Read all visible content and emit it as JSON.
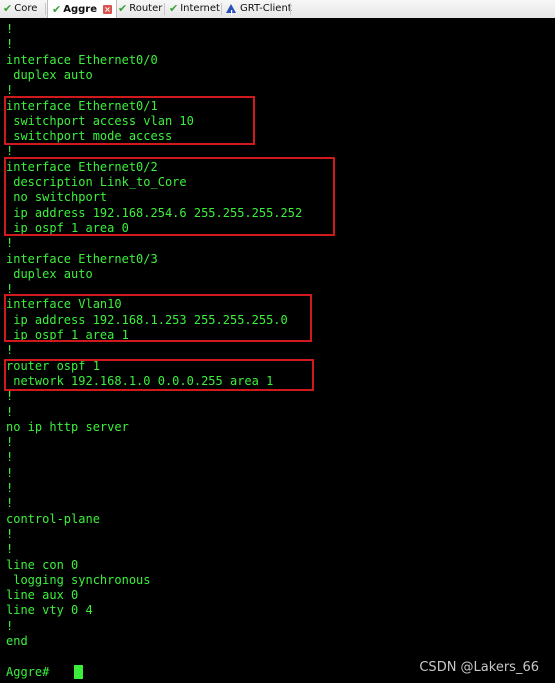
{
  "tabs": [
    {
      "label": "Core",
      "status": "ok"
    },
    {
      "label": "Aggre",
      "status": "ok",
      "active": true
    },
    {
      "label": "Router",
      "status": "ok"
    },
    {
      "label": "Internet",
      "status": "ok"
    },
    {
      "label": "GRT-Client",
      "status": "warning"
    }
  ],
  "terminal": {
    "lines": [
      "!",
      "!",
      "interface Ethernet0/0",
      " duplex auto",
      "!",
      "interface Ethernet0/1",
      " switchport access vlan 10",
      " switchport mode access",
      "!",
      "interface Ethernet0/2",
      " description Link_to_Core",
      " no switchport",
      " ip address 192.168.254.6 255.255.255.252",
      " ip ospf 1 area 0",
      "!",
      "interface Ethernet0/3",
      " duplex auto",
      "!",
      "interface Vlan10",
      " ip address 192.168.1.253 255.255.255.0",
      " ip ospf 1 area 1",
      "!",
      "router ospf 1",
      " network 192.168.1.0 0.0.0.255 area 1",
      "!",
      "!",
      "no ip http server",
      "!",
      "!",
      "!",
      "!",
      "!",
      "control-plane",
      "!",
      "!",
      "line con 0",
      " logging synchronous",
      "line aux 0",
      "line vty 0 4",
      "!",
      "end",
      "",
      "Aggre#"
    ]
  },
  "watermark": "CSDN @Lakers_66",
  "colors": {
    "terminal_bg": "#000000",
    "terminal_text": "#3cf03c",
    "highlight_box": "#d0191d"
  }
}
